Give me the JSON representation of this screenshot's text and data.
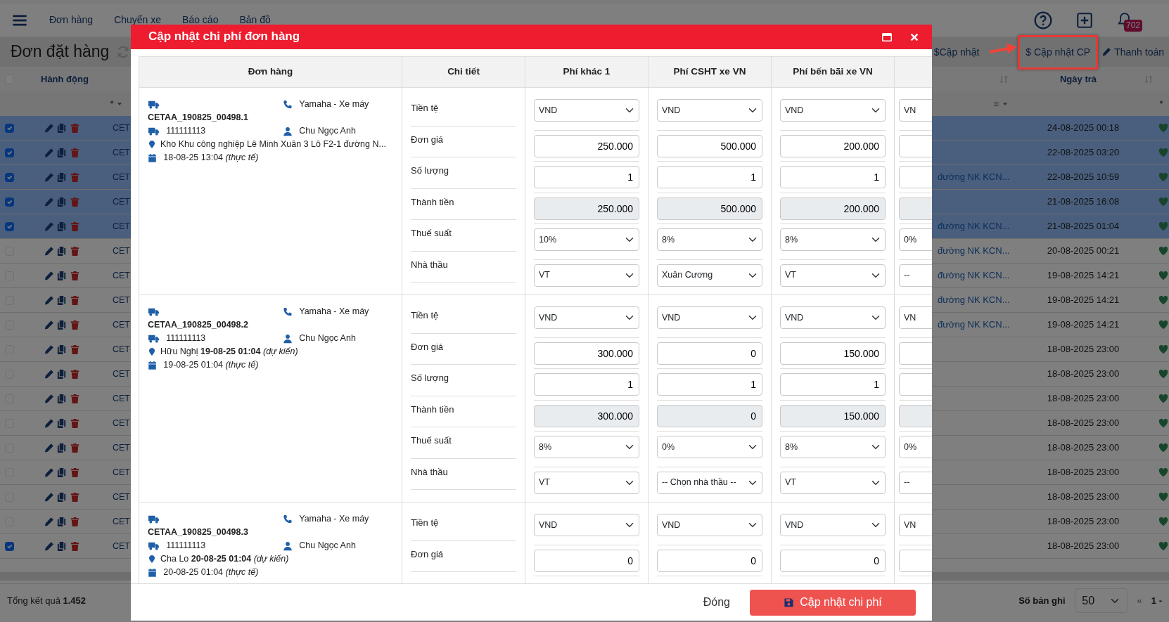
{
  "navbar": {
    "menu": [
      "Đơn hàng",
      "Chuyến xe",
      "Báo cáo",
      "Bản đồ"
    ],
    "badge": "702"
  },
  "page": {
    "title": "Đơn đặt hàng",
    "toolbar": [
      {
        "label": "$Cập nhật",
        "kind": "plain",
        "highlighted": false
      },
      {
        "label": "$ Cập nhật CP",
        "kind": "plain",
        "highlighted": true
      },
      {
        "label": "Thanh toán",
        "kind": "pencil",
        "highlighted": false
      }
    ]
  },
  "table": {
    "select_all": false,
    "columns": {
      "actions": "Hành động",
      "date": "Ngày trả"
    },
    "filters": [
      "*",
      "=",
      "*"
    ],
    "rows": [
      {
        "checked": true,
        "selected": true,
        "code": "CET",
        "date": "24-08-2025 00:18"
      },
      {
        "checked": true,
        "selected": true,
        "code": "CET",
        "date": "22-08-2025 03:20"
      },
      {
        "checked": true,
        "selected": true,
        "code": "CET",
        "address": "đường NK KCN...",
        "date": "22-08-2025 10:59"
      },
      {
        "checked": true,
        "selected": true,
        "code": "CET",
        "date": "21-08-2025 16:08"
      },
      {
        "checked": true,
        "selected": true,
        "code": "CET",
        "address": "đường NK KCN...",
        "date": "21-08-2025 01:04"
      },
      {
        "checked": false,
        "selected": false,
        "code": "CET",
        "address": "đường NK KCN...",
        "date": "20-08-2025 00:21"
      },
      {
        "checked": false,
        "selected": false,
        "code": "CET",
        "address": "đường NK KCN...",
        "date": "19-08-2025 14:21"
      },
      {
        "checked": false,
        "selected": false,
        "code": "CET",
        "address": "đường NK KCN...",
        "date": "19-08-2025 14:21"
      },
      {
        "checked": false,
        "selected": false,
        "code": "CET",
        "address": "đường NK KCN...",
        "date": "19-08-2025 14:21"
      },
      {
        "checked": false,
        "selected": false,
        "code": "CET",
        "date": "18-08-2025 23:00"
      },
      {
        "checked": false,
        "selected": false,
        "code": "CET",
        "date": "18-08-2025 23:00"
      },
      {
        "checked": false,
        "selected": false,
        "code": "CET",
        "date": "18-08-2025 23:00"
      },
      {
        "checked": false,
        "selected": false,
        "code": "CET",
        "date": "18-08-2025 23:00"
      },
      {
        "checked": false,
        "selected": false,
        "code": "CET",
        "date": "18-08-2025 23:00"
      },
      {
        "checked": false,
        "selected": false,
        "code": "CET",
        "date": "18-08-2025 23:00"
      },
      {
        "checked": false,
        "selected": false,
        "code": "CET",
        "date": "18-08-2025 23:00"
      },
      {
        "checked": false,
        "selected": false,
        "code": "CET",
        "date": "18-08-2025 23:00"
      },
      {
        "checked": true,
        "selected": false,
        "code": "CET",
        "date": "18-08-2025 23:00"
      }
    ]
  },
  "footer": {
    "total": "Tổng kết quả **1.452**",
    "page_size_label": "Số bản ghi",
    "page_size": "50",
    "prev": "«",
    "range": "1 -"
  },
  "modal": {
    "title": "Cập nhật chi phí đơn hàng",
    "columns": [
      "Đơn hàng",
      "Chi tiết",
      "Phí khác 1",
      "Phí CSHT xe VN",
      "Phí bến bãi xe VN"
    ],
    "orders": [
      {
        "customer": "Yamaha - Xe máy",
        "code": "CETAA_190825_00498.1",
        "plate": "111111113",
        "driver": "Chu Ngọc Anh",
        "location": "Kho Khu công nghiệp Lê Minh Xuân 3 Lô F2-1 đường N...",
        "date": "18-08-25 13:04 *(thực tế)*",
        "details": [
          {
            "label": "Tiền tệ",
            "kind": "select",
            "values": [
              "VND",
              "VND",
              "VND",
              "VN"
            ]
          },
          {
            "label": "Đơn giá",
            "kind": "input",
            "values": [
              "250.000",
              "500.000",
              "200.000"
            ]
          },
          {
            "label": "Số lượng",
            "kind": "input",
            "values": [
              "1",
              "1",
              "1"
            ]
          },
          {
            "label": "Thành tiền",
            "kind": "readonly",
            "values": [
              "250.000",
              "500.000",
              "200.000"
            ]
          },
          {
            "label": "Thuế suất",
            "kind": "select",
            "values": [
              "10%",
              "8%",
              "8%",
              "0%"
            ]
          },
          {
            "label": "Nhà thầu",
            "kind": "select",
            "values": [
              "VT",
              "Xuân Cương",
              "VT",
              "--"
            ]
          }
        ]
      },
      {
        "customer": "Yamaha - Xe máy",
        "code": "CETAA_190825_00498.2",
        "plate": "111111113",
        "driver": "Chu Ngọc Anh",
        "location": "Hữu Nghị **19-08-25 01:04** *(dự kiến)*",
        "date": "19-08-25 01:04 *(thực tế)*",
        "details": [
          {
            "label": "Tiền tệ",
            "kind": "select",
            "values": [
              "VND",
              "VND",
              "VND",
              "VN"
            ]
          },
          {
            "label": "Đơn giá",
            "kind": "input",
            "values": [
              "300.000",
              "0",
              "150.000"
            ]
          },
          {
            "label": "Số lượng",
            "kind": "input",
            "values": [
              "1",
              "1",
              "1"
            ]
          },
          {
            "label": "Thành tiền",
            "kind": "readonly",
            "values": [
              "300.000",
              "0",
              "150.000"
            ]
          },
          {
            "label": "Thuế suất",
            "kind": "select",
            "values": [
              "8%",
              "0%",
              "8%",
              "0%"
            ]
          },
          {
            "label": "Nhà thầu",
            "kind": "select",
            "values": [
              "VT",
              "-- Chọn nhà thầu --",
              "VT",
              "--"
            ]
          }
        ]
      },
      {
        "customer": "Yamaha - Xe máy",
        "code": "CETAA_190825_00498.3",
        "plate": "111111113",
        "driver": "Chu Ngọc Anh",
        "location": "Cha Lo **20-08-25 01:04** *(dự kiến)*",
        "date": "20-08-25 01:04 *(thực tế)*",
        "details": [
          {
            "label": "Tiền tệ",
            "kind": "select",
            "values": [
              "VND",
              "VND",
              "VND",
              "VN"
            ]
          },
          {
            "label": "Đơn giá",
            "kind": "input",
            "values": [
              "0",
              "0",
              "0"
            ]
          }
        ]
      }
    ],
    "buttons": {
      "close": "Đóng",
      "submit": "Cập nhật chi phí"
    }
  }
}
